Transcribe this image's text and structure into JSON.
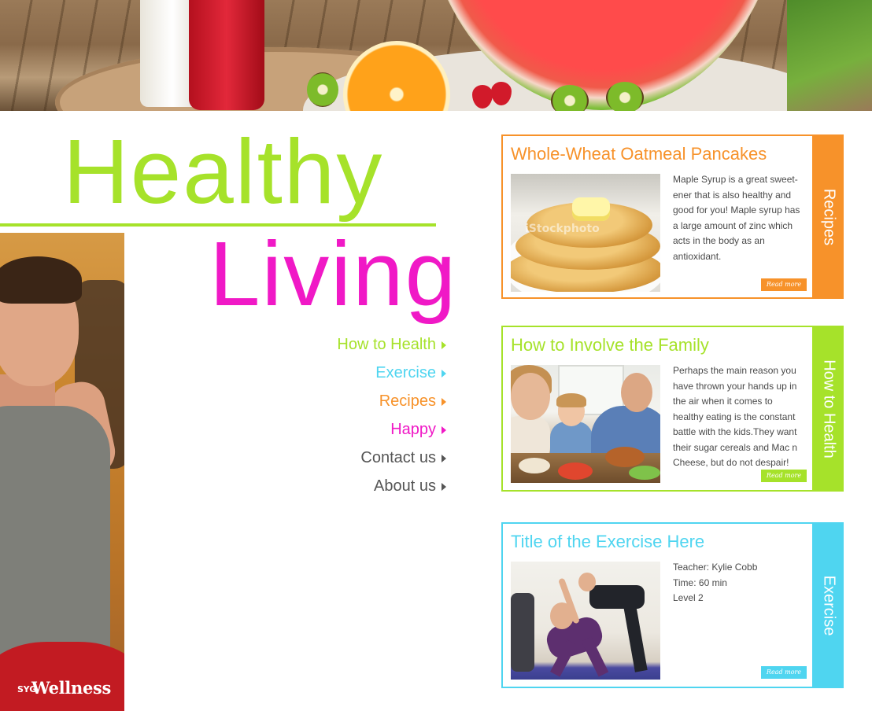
{
  "headline": {
    "line1": "Healthy",
    "line2": "Living"
  },
  "colors": {
    "green": "#a6e22a",
    "magenta": "#f019c6",
    "orange": "#f7922a",
    "cyan": "#4fd5f0",
    "gray": "#555555"
  },
  "nav": {
    "items": [
      {
        "label": "How to Health",
        "color": "#a6e22a"
      },
      {
        "label": "Exercise",
        "color": "#4fd5f0"
      },
      {
        "label": "Recipes",
        "color": "#f7922a"
      },
      {
        "label": "Happy",
        "color": "#f019c6"
      },
      {
        "label": "Contact us",
        "color": "#555555"
      },
      {
        "label": "About us",
        "color": "#555555"
      }
    ]
  },
  "brand": {
    "logo_text": "Wellness",
    "logo_mark": "SYG"
  },
  "cards": [
    {
      "category": "Recipes",
      "title": "Whole-Wheat Oatmeal Pancakes",
      "description": "Maple Syrup is a great sweet-ener that is also healthy and good for you!  Maple syrup has a large amount of zinc which acts in the body as an antioxidant.",
      "image_watermark": "iStockphoto",
      "read_more": "Read more",
      "color": "#f7922a"
    },
    {
      "category": "How to Health",
      "title": "How to Involve the Family",
      "description": "Perhaps the main reason you have thrown your hands up in the air when it comes to healthy eating is the constant battle with the kids.They want their sugar cereals and Mac n Cheese, but do not despair!",
      "read_more": "Read more",
      "color": "#a6e22a"
    },
    {
      "category": "Exercise",
      "title": "Title of the Exercise Here",
      "details": [
        "Teacher: Kylie Cobb",
        "Time: 60 min",
        "Level 2"
      ],
      "read_more": "Read more",
      "color": "#4fd5f0"
    }
  ]
}
